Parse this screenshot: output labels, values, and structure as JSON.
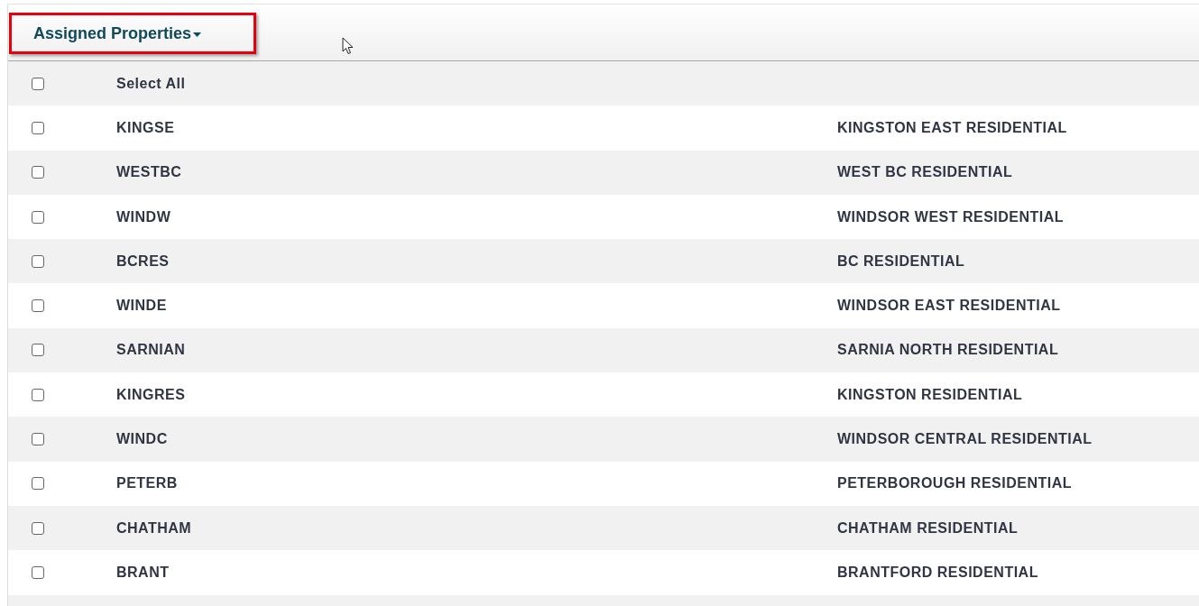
{
  "header": {
    "dropdown": {
      "label": "Assigned Properties",
      "highlighted": true
    }
  },
  "select_all": {
    "label": "Select All",
    "checked": false
  },
  "rows": [
    {
      "code": "KINGSE",
      "description": "KINGSTON EAST RESIDENTIAL",
      "checked": false
    },
    {
      "code": "WESTBC",
      "description": "WEST BC RESIDENTIAL",
      "checked": false
    },
    {
      "code": "WINDW",
      "description": "WINDSOR WEST RESIDENTIAL",
      "checked": false
    },
    {
      "code": "BCRES",
      "description": "BC RESIDENTIAL",
      "checked": false
    },
    {
      "code": "WINDE",
      "description": "WINDSOR EAST RESIDENTIAL",
      "checked": false
    },
    {
      "code": "SARNIAN",
      "description": "SARNIA NORTH RESIDENTIAL",
      "checked": false
    },
    {
      "code": "KINGRES",
      "description": "KINGSTON RESIDENTIAL",
      "checked": false
    },
    {
      "code": "WINDC",
      "description": "WINDSOR CENTRAL RESIDENTIAL",
      "checked": false
    },
    {
      "code": "PETERB",
      "description": "PETERBOROUGH RESIDENTIAL",
      "checked": false
    },
    {
      "code": "CHATHAM",
      "description": "CHATHAM RESIDENTIAL",
      "checked": false
    },
    {
      "code": "BRANT",
      "description": "BRANTFORD RESIDENTIAL",
      "checked": false
    }
  ]
}
